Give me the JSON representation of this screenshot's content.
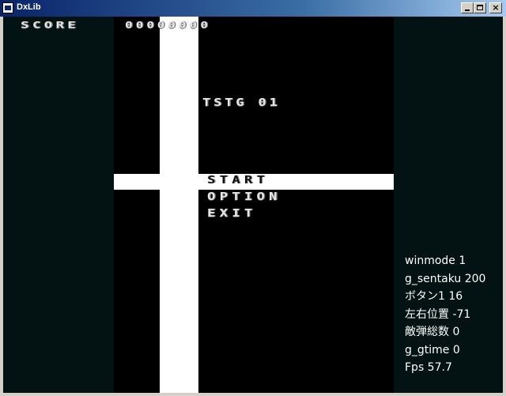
{
  "window": {
    "title": "DxLib",
    "controls": {
      "minimize": "_",
      "maximize": "□",
      "close": "×"
    }
  },
  "hud": {
    "score_label": "SCORE",
    "score_value": "00000000"
  },
  "title_screen": {
    "game_title": "TSTG 01",
    "menu": [
      {
        "label": "START",
        "selected": true
      },
      {
        "label": "OPTION",
        "selected": false
      },
      {
        "label": "EXIT",
        "selected": false
      }
    ]
  },
  "debug_info": [
    "winmode 1",
    "g_sentaku 200",
    "ボタン1 16",
    "左右位置 -71",
    "敵弾総数 0",
    "g_gtime 0",
    "Fps 57.7"
  ],
  "colors": {
    "side_panel": "#031212",
    "playfield": "#000000",
    "highlight": "#ffffff",
    "titlebar": "#0a246a"
  }
}
